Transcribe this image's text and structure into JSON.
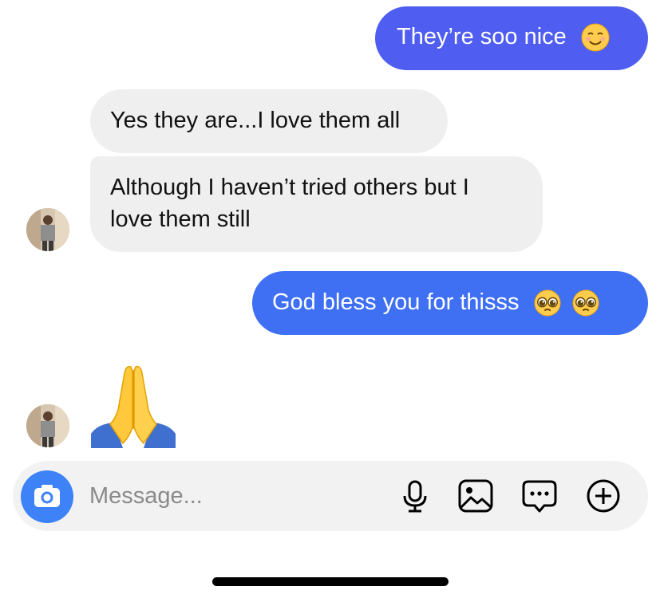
{
  "messages": [
    {
      "id": "m1",
      "direction": "outgoing",
      "text": "They’re soo nice",
      "emoji": "smiling-face-emoji"
    },
    {
      "id": "m2",
      "direction": "incoming",
      "text": "Yes they are...I love them all"
    },
    {
      "id": "m3",
      "direction": "incoming",
      "line1": "Although I haven’t tried others but I",
      "line2": "love them still"
    },
    {
      "id": "m4",
      "direction": "outgoing",
      "text": "God bless you for thisss",
      "emoji": "pleading-face-emoji"
    },
    {
      "id": "m5",
      "direction": "incoming",
      "emoji": "folded-hands-emoji"
    }
  ],
  "composer": {
    "placeholder": "Message...",
    "icons": [
      "camera-icon",
      "microphone-icon",
      "gallery-icon",
      "sticker-chat-icon",
      "add-icon"
    ]
  },
  "colors": {
    "outgoing_bubble_top": "#4f5ef0",
    "outgoing_bubble_bottom": "#3f70f3",
    "incoming_bubble": "#efefef",
    "camera_button": "#3e82f7"
  }
}
